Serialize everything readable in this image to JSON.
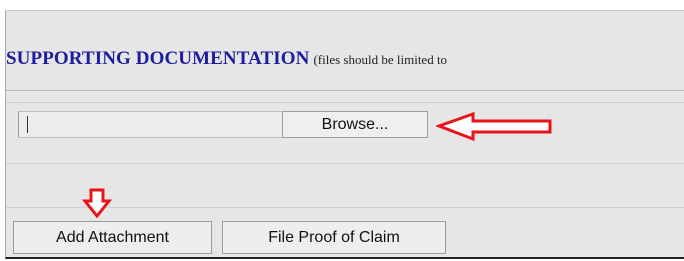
{
  "section": {
    "title": "SUPPORTING DOCUMENTATION",
    "note": "(files should be limited to"
  },
  "file_upload": {
    "value": "",
    "browse_label": "Browse..."
  },
  "actions": {
    "add_attachment_label": "Add Attachment",
    "file_proof_label": "File Proof of Claim"
  },
  "annotations": {
    "arrow_color": "#e8141b",
    "left_arrow_icon": "arrow-left-outline-icon",
    "down_arrow_icon": "arrow-down-outline-icon"
  }
}
